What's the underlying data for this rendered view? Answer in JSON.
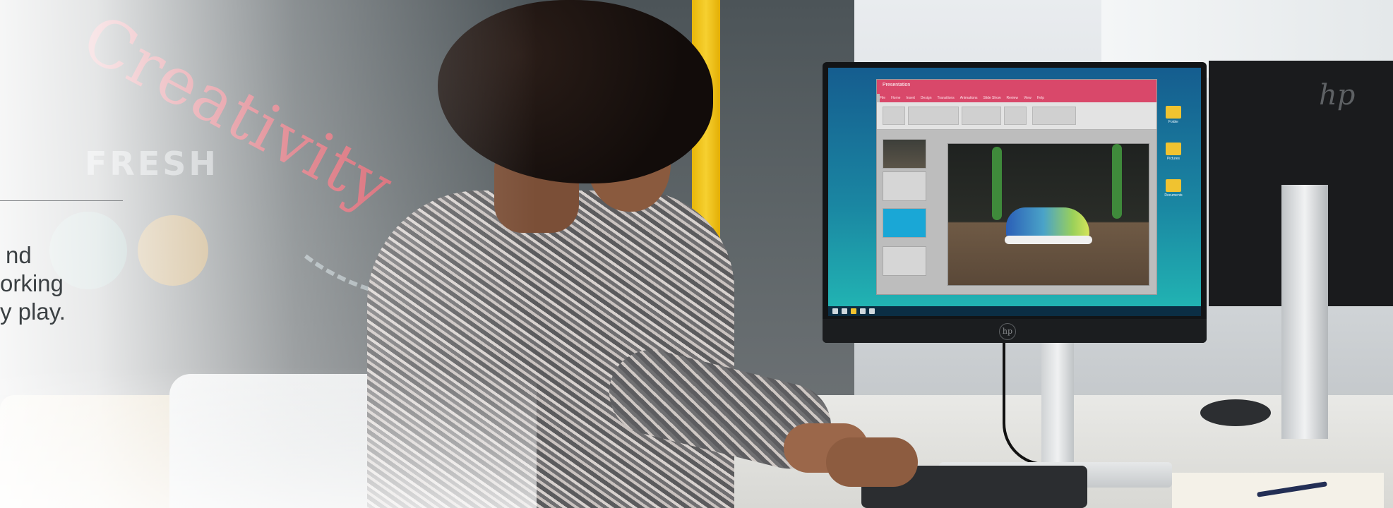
{
  "hero": {
    "text_lines": [
      "nd",
      "orking",
      "y play."
    ]
  },
  "monitor": {
    "brand_mark": "hp",
    "app_window": {
      "title": "Presentation",
      "menu_items": [
        "File",
        "Home",
        "Insert",
        "Design",
        "Transitions",
        "Animations",
        "Slide Show",
        "Review",
        "View",
        "Help"
      ]
    },
    "desktop_icons": [
      "Folder",
      "Pictures",
      "Documents"
    ]
  },
  "second_monitor": {
    "brand_mark": "hp"
  },
  "colors": {
    "accent_yellow": "#f6d030",
    "ppt_titlebar": "#d9486a",
    "chalk_red": "#e8505f",
    "screen_teal": "#22b7b4"
  },
  "icons": [
    "folder-icon",
    "hp-logo-icon",
    "windows-start-icon"
  ]
}
